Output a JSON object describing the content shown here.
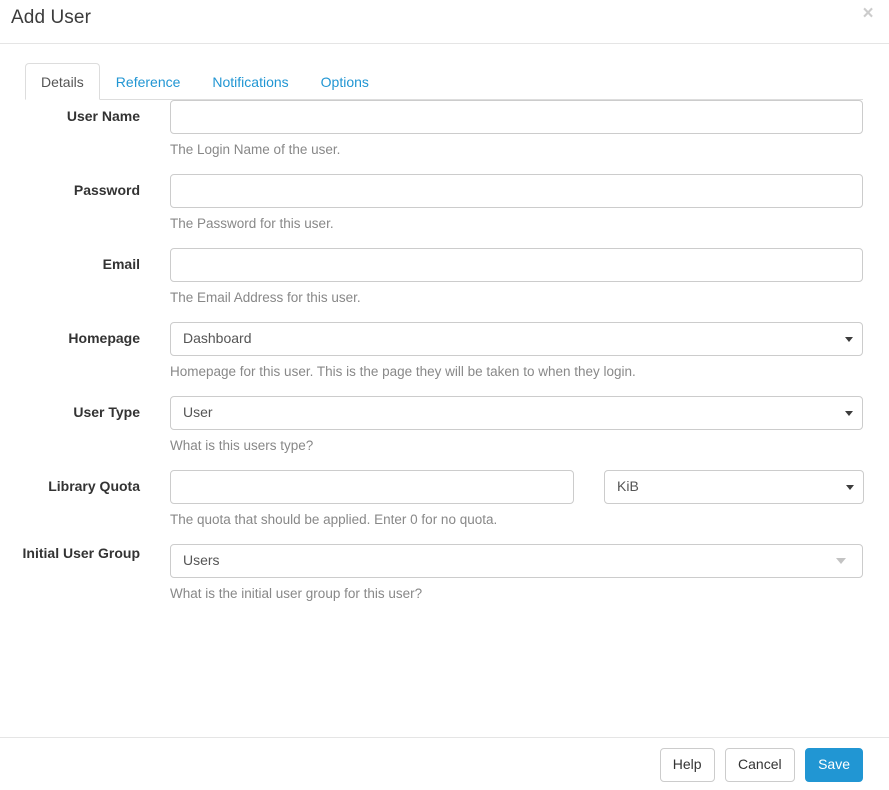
{
  "header": {
    "title": "Add User",
    "close_icon": "close-icon",
    "close_glyph": "×"
  },
  "tabs": [
    {
      "label": "Details",
      "active": true
    },
    {
      "label": "Reference",
      "active": false
    },
    {
      "label": "Notifications",
      "active": false
    },
    {
      "label": "Options",
      "active": false
    }
  ],
  "form": {
    "user_name": {
      "label": "User Name",
      "value": "",
      "placeholder": "",
      "help": "The Login Name of the user."
    },
    "password": {
      "label": "Password",
      "value": "",
      "placeholder": "",
      "help": "The Password for this user."
    },
    "email": {
      "label": "Email",
      "value": "",
      "placeholder": "",
      "help": "The Email Address for this user."
    },
    "homepage": {
      "label": "Homepage",
      "selected": "Dashboard",
      "options": [
        "Dashboard"
      ],
      "help": "Homepage for this user. This is the page they will be taken to when they login."
    },
    "user_type": {
      "label": "User Type",
      "selected": "User",
      "options": [
        "User"
      ],
      "help": "What is this users type?"
    },
    "library_quota": {
      "label": "Library Quota",
      "value": "",
      "placeholder": "",
      "unit_selected": "KiB",
      "unit_options": [
        "KiB"
      ],
      "help": "The quota that should be applied. Enter 0 for no quota."
    },
    "initial_user_group": {
      "label": "Initial User Group",
      "selected": "Users",
      "options": [
        "Users"
      ],
      "help": "What is the initial user group for this user?"
    }
  },
  "footer": {
    "help_label": "Help",
    "cancel_label": "Cancel",
    "save_label": "Save"
  },
  "colors": {
    "primary": "#2196d3",
    "link": "#2196d3",
    "border": "#cccccc",
    "help_text": "#888888",
    "label": "#333333"
  }
}
